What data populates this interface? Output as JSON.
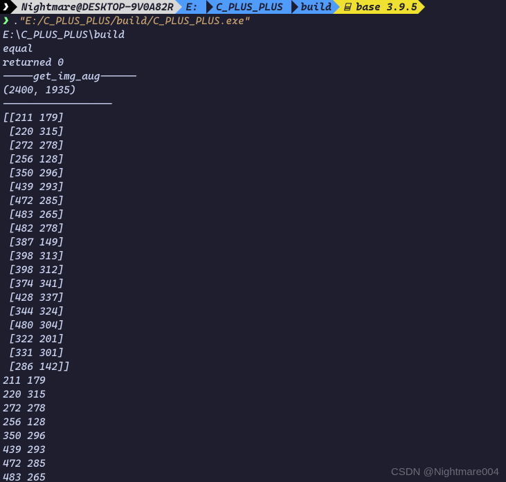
{
  "breadcrumb": {
    "s0_icon": "❯",
    "s1": "Nightmare@DESKTOP-9V0A82R",
    "s2": "E:",
    "s3": "C_PLUS_PLUS",
    "s4": "build",
    "s5": "⌸ base 3.9.5"
  },
  "prompt": {
    "caret": "❯",
    "dot": ". ",
    "command": "\"E:/C_PLUS_PLUS/build/C_PLUS_PLUS.exe\""
  },
  "output_lines": [
    "E:\\C_PLUS_PLUS\\build",
    "equal",
    "returned 0",
    "-----get_img_aug------",
    "(2400, 1935)",
    "------------------",
    "[[211 179]",
    " [220 315]",
    " [272 278]",
    " [256 128]",
    " [350 296]",
    " [439 293]",
    " [472 285]",
    " [483 265]",
    " [482 278]",
    " [387 149]",
    " [398 313]",
    " [398 312]",
    " [374 341]",
    " [428 337]",
    " [344 324]",
    " [480 304]",
    " [322 201]",
    " [331 301]",
    " [286 142]]",
    "211 179",
    "220 315",
    "272 278",
    "256 128",
    "350 296",
    "439 293",
    "472 285",
    "483 265"
  ],
  "watermark": "CSDN @Nightmare004"
}
